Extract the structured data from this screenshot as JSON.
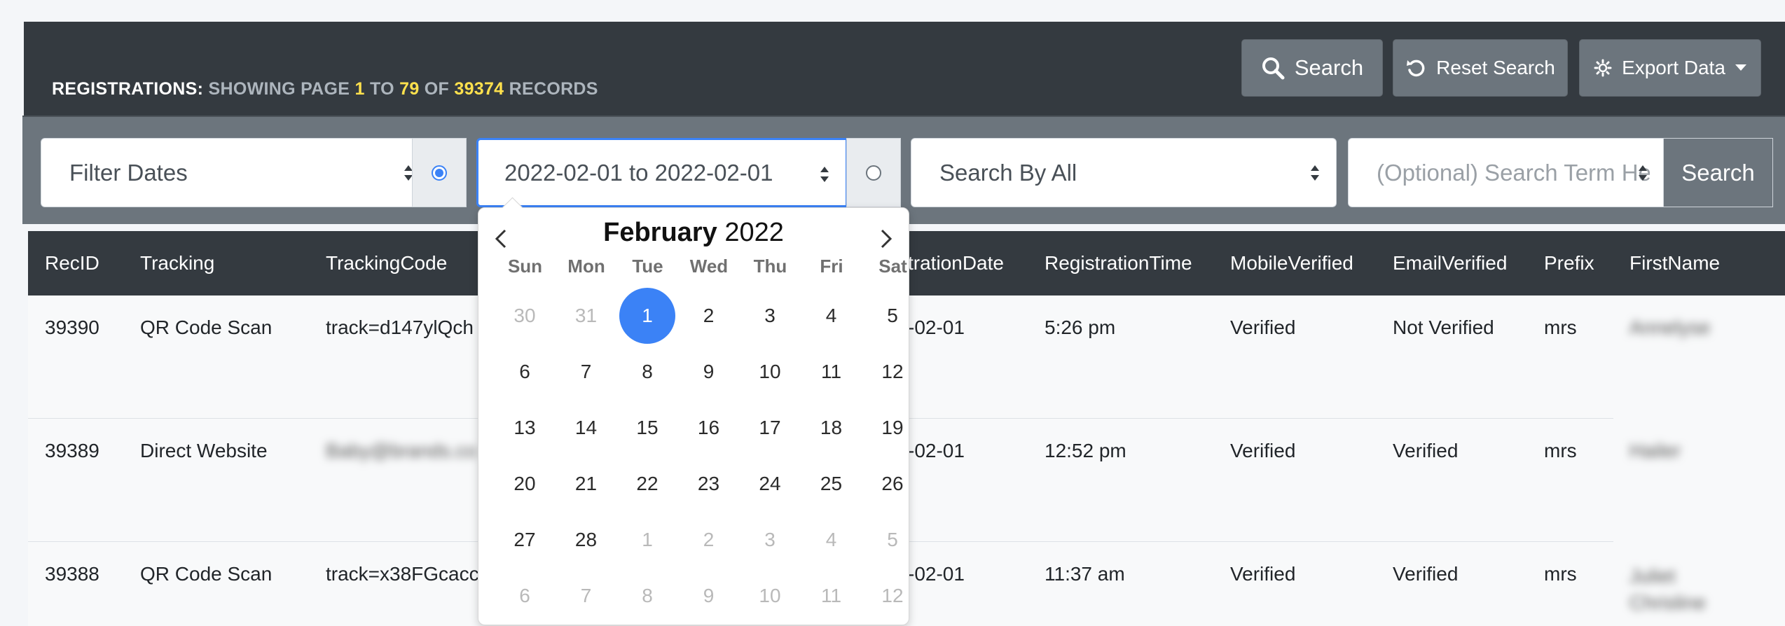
{
  "header": {
    "title_label": "REGISTRATIONS:",
    "title_showing": "SHOWING PAGE",
    "page_from": "1",
    "to_word": "TO",
    "page_to": "79",
    "of_word": "OF",
    "total_records": "39374",
    "records_word": "RECORDS",
    "search_label": "Search",
    "reset_label": "Reset Search",
    "export_label": "Export Data"
  },
  "filters": {
    "filter_dates": "Filter Dates",
    "date_range": "2022-02-01 to 2022-02-01",
    "search_by": "Search By All",
    "search_term_placeholder": "(Optional) Search Term Here",
    "search_button": "Search"
  },
  "table": {
    "headers": [
      "RecID",
      "Tracking",
      "TrackingCode",
      "trationDate",
      "RegistrationTime",
      "MobileVerified",
      "EmailVerified",
      "Prefix",
      "FirstName"
    ],
    "rows": [
      [
        "39390",
        "QR Code Scan",
        "track=d147ylQch",
        "-02-01",
        "5:26 pm",
        "Verified",
        "Not Verified",
        "mrs",
        "Annelyse"
      ],
      [
        "39389",
        "Direct Website",
        "Baby@brands.co",
        "-02-01",
        "12:52 pm",
        "Verified",
        "Verified",
        "mrs",
        "Hailer"
      ],
      [
        "39388",
        "QR Code Scan",
        "track=x38FGcacc",
        "-02-01",
        "11:37 am",
        "Verified",
        "Verified",
        "mrs",
        "Juliet Chrisline"
      ]
    ]
  },
  "calendar": {
    "month": "February",
    "year": "2022",
    "weekdays": [
      "Sun",
      "Mon",
      "Tue",
      "Wed",
      "Thu",
      "Fri",
      "Sat"
    ],
    "weeks": [
      [
        "30",
        "31",
        "1",
        "2",
        "3",
        "4",
        "5"
      ],
      [
        "6",
        "7",
        "8",
        "9",
        "10",
        "11",
        "12"
      ],
      [
        "13",
        "14",
        "15",
        "16",
        "17",
        "18",
        "19"
      ],
      [
        "20",
        "21",
        "22",
        "23",
        "24",
        "25",
        "26"
      ],
      [
        "27",
        "28",
        "1",
        "2",
        "3",
        "4",
        "5"
      ],
      [
        "6",
        "7",
        "8",
        "9",
        "10",
        "11",
        "12"
      ]
    ],
    "selected_date": "2022-02-01"
  },
  "colors": {
    "header_bg": "#343a40",
    "filterbar_bg": "#6c757d",
    "highlight_yellow": "#ffe14d",
    "selected_day": "#3b82f6"
  }
}
